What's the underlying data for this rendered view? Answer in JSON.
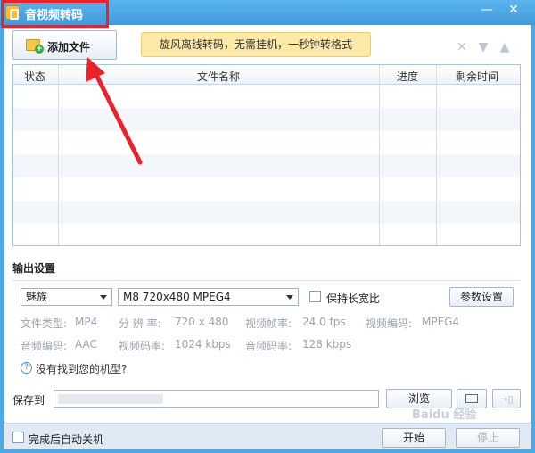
{
  "window": {
    "title": "音视频转码",
    "controls": {
      "minimize": "—",
      "close": "✕"
    }
  },
  "toolbar": {
    "add_file_label": "添加文件",
    "banner_text": "旋风离线转码，无需挂机，一秒钟转格式",
    "icons": [
      "delete-icon",
      "move-down-icon",
      "move-up-icon"
    ]
  },
  "file_table": {
    "columns": [
      "状态",
      "文件名称",
      "进度",
      "剩余时间"
    ],
    "rows": []
  },
  "output_settings": {
    "section_title": "输出设置",
    "device_select": "魅族",
    "format_select": "M8 720x480 MPEG4",
    "keep_aspect_label": "保持长宽比",
    "keep_aspect_checked": false,
    "params_button": "参数设置",
    "info": {
      "file_type_label": "文件类型:",
      "file_type_value": "MP4",
      "resolution_label": "分 辨 率:",
      "resolution_value": "720 x 480",
      "video_fps_label": "视频帧率:",
      "video_fps_value": "24.0 fps",
      "video_codec_label": "视频编码:",
      "video_codec_value": "MPEG4",
      "audio_codec_label": "音频编码:",
      "audio_codec_value": "AAC",
      "video_bitrate_label": "视频码率:",
      "video_bitrate_value": "1024 kbps",
      "audio_bitrate_label": "音频码率:",
      "audio_bitrate_value": "128 kbps"
    },
    "help_text": "没有找到您的机型?"
  },
  "save": {
    "label": "保存到",
    "browse_button": "浏览"
  },
  "bottom": {
    "auto_shutdown_label": "完成后自动关机",
    "auto_shutdown_checked": false,
    "start_button": "开始",
    "stop_button": "停止"
  },
  "watermark": "Baidu 经验",
  "colors": {
    "titlebar": "#4fa7e3",
    "banner_bg": "#fde9a8",
    "highlight_red": "#e8232b"
  }
}
